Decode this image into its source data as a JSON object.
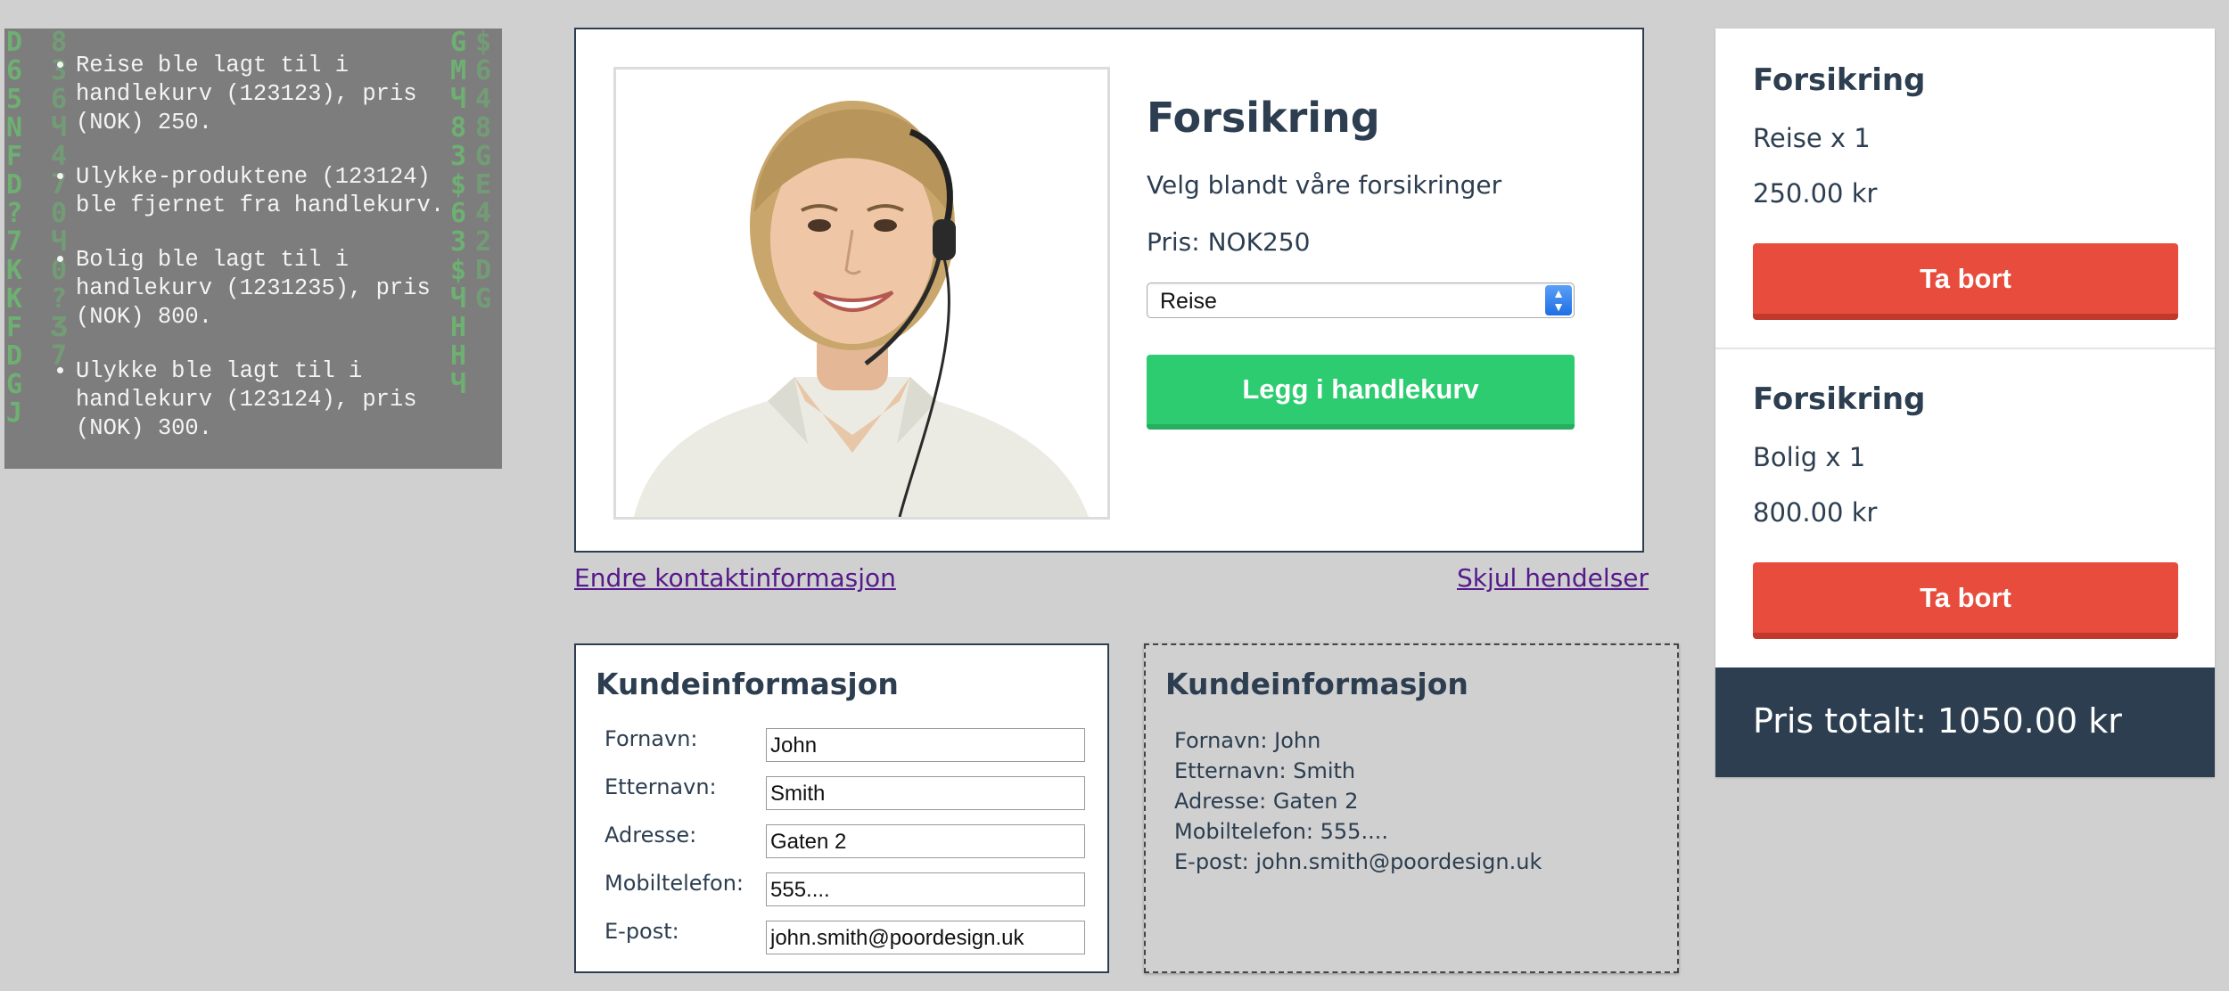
{
  "events": {
    "items": [
      "Reise ble lagt til i handlekurv (123123), pris (NOK) 250.",
      "Ulykke-produktene (123124) ble fjernet fra handlekurv.",
      "Bolig ble lagt til i handlekurv (1231235), pris (NOK) 800.",
      "Ulykke ble lagt til i handlekurv (123124), pris (NOK) 300."
    ]
  },
  "product": {
    "title": "Forsikring",
    "description": "Velg blandt våre forsikringer",
    "price": "Pris: NOK250",
    "selected_option": "Reise",
    "add_button": "Legg i handlekurv"
  },
  "links": {
    "edit_contact": "Endre kontaktinformasjon",
    "hide_events": "Skjul hendelser"
  },
  "customer_form": {
    "title": "Kundeinformasjon",
    "fields": [
      {
        "label": "Fornavn:",
        "value": "John"
      },
      {
        "label": "Etternavn:",
        "value": "Smith"
      },
      {
        "label": "Adresse:",
        "value": "Gaten 2"
      },
      {
        "label": "Mobiltelefon:",
        "value": "555...."
      },
      {
        "label": "E-post:",
        "value": "john.smith@poordesign.uk"
      }
    ]
  },
  "customer_view": {
    "title": "Kundeinformasjon",
    "lines": [
      "Fornavn: John",
      "Etternavn: Smith",
      "Adresse: Gaten 2",
      "Mobiltelefon: 555....",
      "E-post: john.smith@poordesign.uk"
    ]
  },
  "cart": {
    "items": [
      {
        "title": "Forsikring",
        "qty": "Reise x 1",
        "amount": "250.00 kr",
        "remove_label": "Ta bort"
      },
      {
        "title": "Forsikring",
        "qty": "Bolig x 1",
        "amount": "800.00 kr",
        "remove_label": "Ta bort"
      }
    ],
    "total": "Pris totalt: 1050.00 kr"
  },
  "colors": {
    "primary": "#2c3e50",
    "add_button": "#2ecc71",
    "remove_button": "#e74c3c",
    "matrix_glyphs": "#62d86a"
  }
}
